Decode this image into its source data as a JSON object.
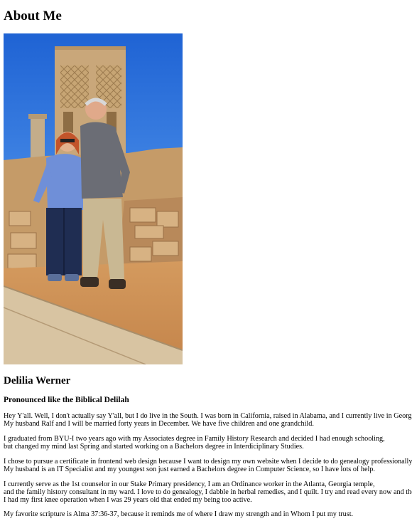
{
  "page": {
    "title": "About Me"
  },
  "photo": {
    "alt": "Photo of Delilia and Ralf Werner standing in front of a stone tower ruin",
    "colors": {
      "sky": "#2a6fd8",
      "stone": "#c9a77a",
      "ground": "#c98f55"
    }
  },
  "profile": {
    "name": "Delilia Werner",
    "pronunciation": "Pronounced like the Biblical Delilah"
  },
  "paragraphs": [
    {
      "lines": [
        "Hey Y'all. Well, I don't actually say Y'all, but I do live in the South. I was born in California, raised in Alabama, and I currently live in Georgia.",
        "My husband Ralf and I will be married forty years in December. We have five children and one grandchild."
      ]
    },
    {
      "lines": [
        "I graduated from BYU-I two years ago with my Associates degree in Family History Research and decided I had enough schooling,",
        "but changed my mind last Spring and started working on a Bachelors degree in Interdiciplinary Studies."
      ]
    },
    {
      "lines": [
        "I chose to pursue a certificate in frontend web design because I want to design my own website when I decide to do genealogy professionally.",
        "My husband is an IT Specialist and my youngest son just earned a Bachelors degree in Computer Science, so I have lots of help."
      ]
    },
    {
      "lines": [
        "I currently serve as the 1st counselor in our Stake Primary presidency, I am an Ordinance worker in the Atlanta, Georgia temple,",
        "and the family history consultant in my ward. I love to do genealogy, I dabble in herbal remedies, and I quilt. I try and read every now and then, too.",
        "I had my first knee operation when I was 29 years old that ended my being too active."
      ]
    },
    {
      "lines": [
        "My favorite scripture is Alma 37:36-37, because it reminds me of where I draw my strength and in Whom I put my trust."
      ]
    }
  ]
}
